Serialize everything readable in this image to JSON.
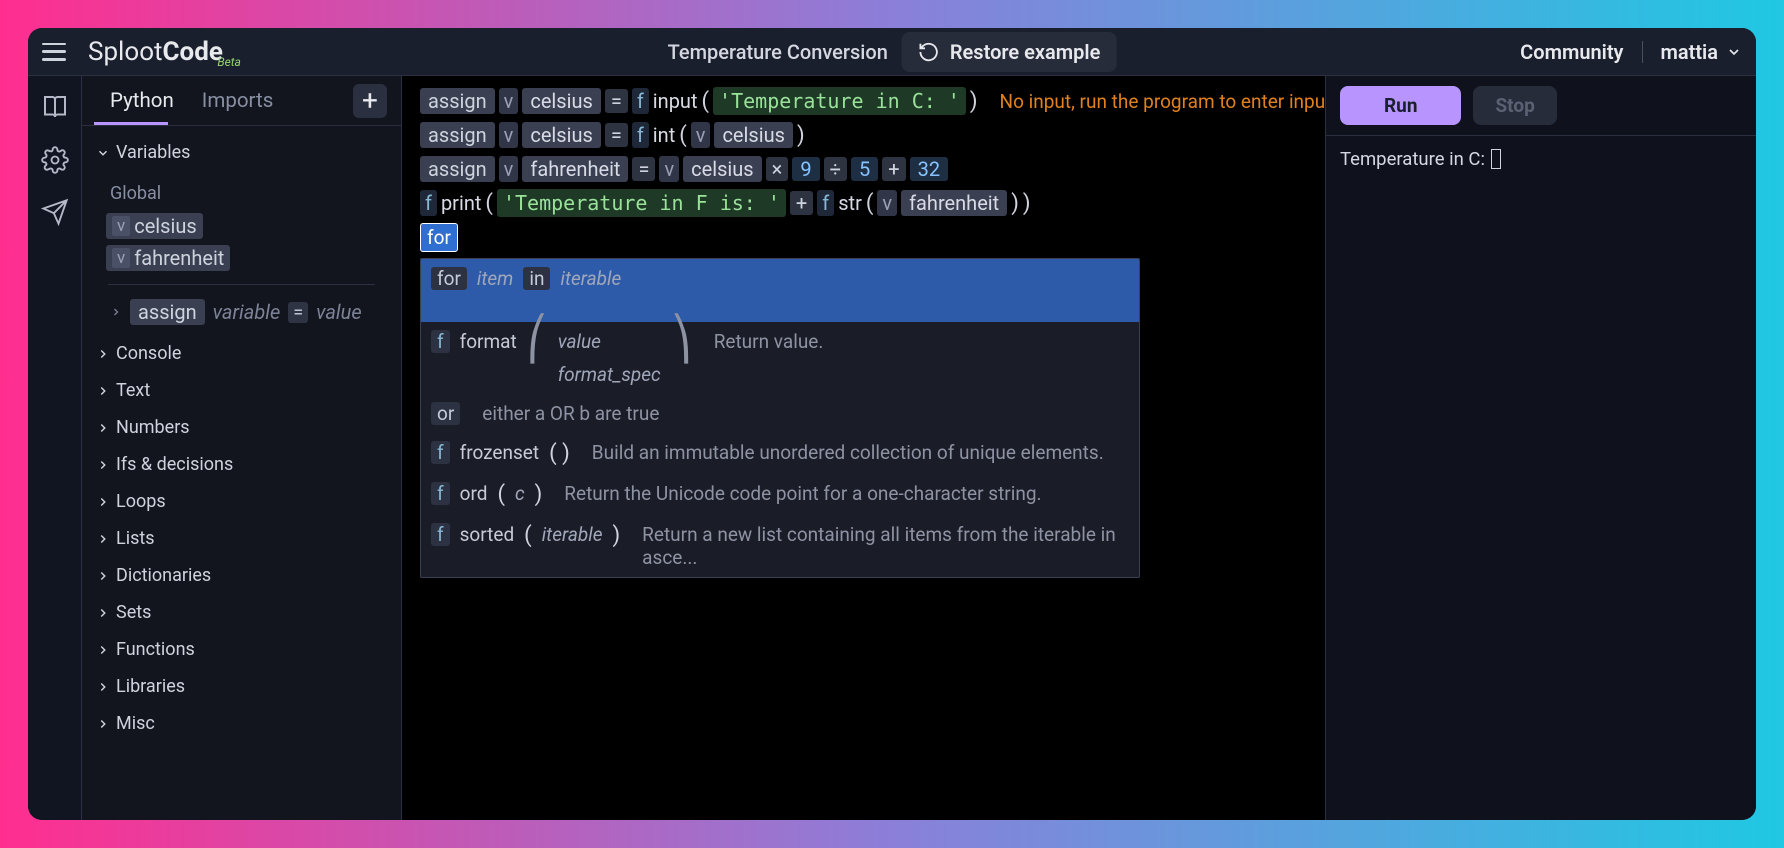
{
  "header": {
    "brand_pre": "Sploot",
    "brand_bold": "Code",
    "brand_beta": "Beta",
    "title": "Temperature Conversion",
    "restore": "Restore example",
    "community": "Community",
    "user": "mattia"
  },
  "tabs": {
    "python": "Python",
    "imports": "Imports"
  },
  "sidebar": {
    "variables": "Variables",
    "global": "Global",
    "var1": "celsius",
    "var2": "fahrenheit",
    "assign_kw": "assign",
    "assign_var": "variable",
    "assign_eq": "=",
    "assign_val": "value",
    "sections": [
      "Console",
      "Text",
      "Numbers",
      "Ifs & decisions",
      "Loops",
      "Lists",
      "Dictionaries",
      "Sets",
      "Functions",
      "Libraries",
      "Misc"
    ]
  },
  "code": {
    "assign": "assign",
    "v": "v",
    "f": "f",
    "celsius": "celsius",
    "eq": "=",
    "input": "input",
    "str1": "'Temperature in C: '",
    "hint": "No input, run the program to enter inpu",
    "int": "int",
    "fahrenheit": "fahrenheit",
    "times": "×",
    "nine": "9",
    "div": "÷",
    "five": "5",
    "plus": "+",
    "n32": "32",
    "print": "print",
    "str2": "'Temperature in F is: '",
    "strf": "str",
    "for_typed": "for"
  },
  "suggest": {
    "for_kw": "for",
    "item": "item",
    "in": "in",
    "iterable": "iterable",
    "format": "format",
    "format_p1": "value",
    "format_p2": "format_spec",
    "format_desc": "Return value.",
    "or": "or",
    "or_desc": "either a OR b are true",
    "frozenset": "frozenset",
    "frozenset_desc": "Build an immutable unordered collection of unique elements.",
    "ord": "ord",
    "ord_p": "c",
    "ord_desc": "Return the Unicode code point for a one-character string.",
    "sorted": "sorted",
    "sorted_p": "iterable",
    "sorted_desc": "Return a new list containing all items from the iterable in asce..."
  },
  "console": {
    "run": "Run",
    "stop": "Stop",
    "output": "Temperature in C: "
  }
}
